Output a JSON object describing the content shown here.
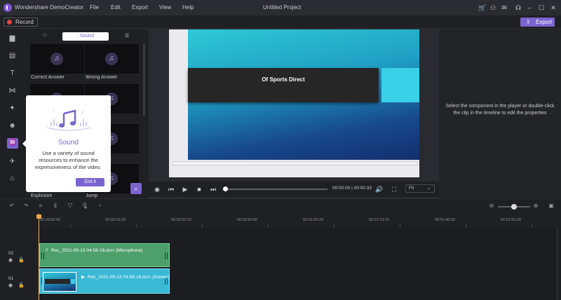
{
  "app": {
    "name": "Wondershare DemoCreator",
    "project_title": "Untitled Project",
    "menu": [
      "File",
      "Edit",
      "Export",
      "View",
      "Help"
    ]
  },
  "toolbar": {
    "record_label": "Record",
    "export_label": "Export"
  },
  "library": {
    "tabs": [
      {
        "icon": "heart-icon",
        "label": ""
      },
      {
        "icon": "sound-wave-icon",
        "label": "Sound"
      },
      {
        "icon": "list-icon",
        "label": ""
      }
    ],
    "items": [
      {
        "label": "Correct Answer"
      },
      {
        "label": "Wrong Answer"
      },
      {
        "label": "Explosion"
      },
      {
        "label": "Jump"
      }
    ]
  },
  "tooltip": {
    "title": "Sound",
    "description": "Use a variety of sound resources to enhance the expressiveness of the video.",
    "button_label": "Got it"
  },
  "player": {
    "slide_title": "Of Sports Direct",
    "timecode": "00:00:00 | 00:00:33",
    "fit_label": "Fit",
    "progress": 0.0
  },
  "properties": {
    "hint": "Select the component in the player or double-click the clip in the timeline to edit the properties"
  },
  "timeline": {
    "ruler": [
      "00:00:00:00",
      "00:00:16:20",
      "00:00:33:10",
      "00:00:50:00",
      "00:01:06:20",
      "00:01:23:10",
      "00:01:40:00",
      "00:01:56:20"
    ],
    "tracks": [
      {
        "number": "02",
        "clip": "Rec_2021-09-13 04-58-16.dcrc (Microphone)"
      },
      {
        "number": "01",
        "clip": "Rec_2021-09-13 04-58-16.dcrc (Screen)"
      }
    ]
  },
  "colors": {
    "accent": "#7b64cf",
    "mic_clip": "#4da06b",
    "screen_clip": "#3ab8d4",
    "playhead": "#e6a84a"
  }
}
